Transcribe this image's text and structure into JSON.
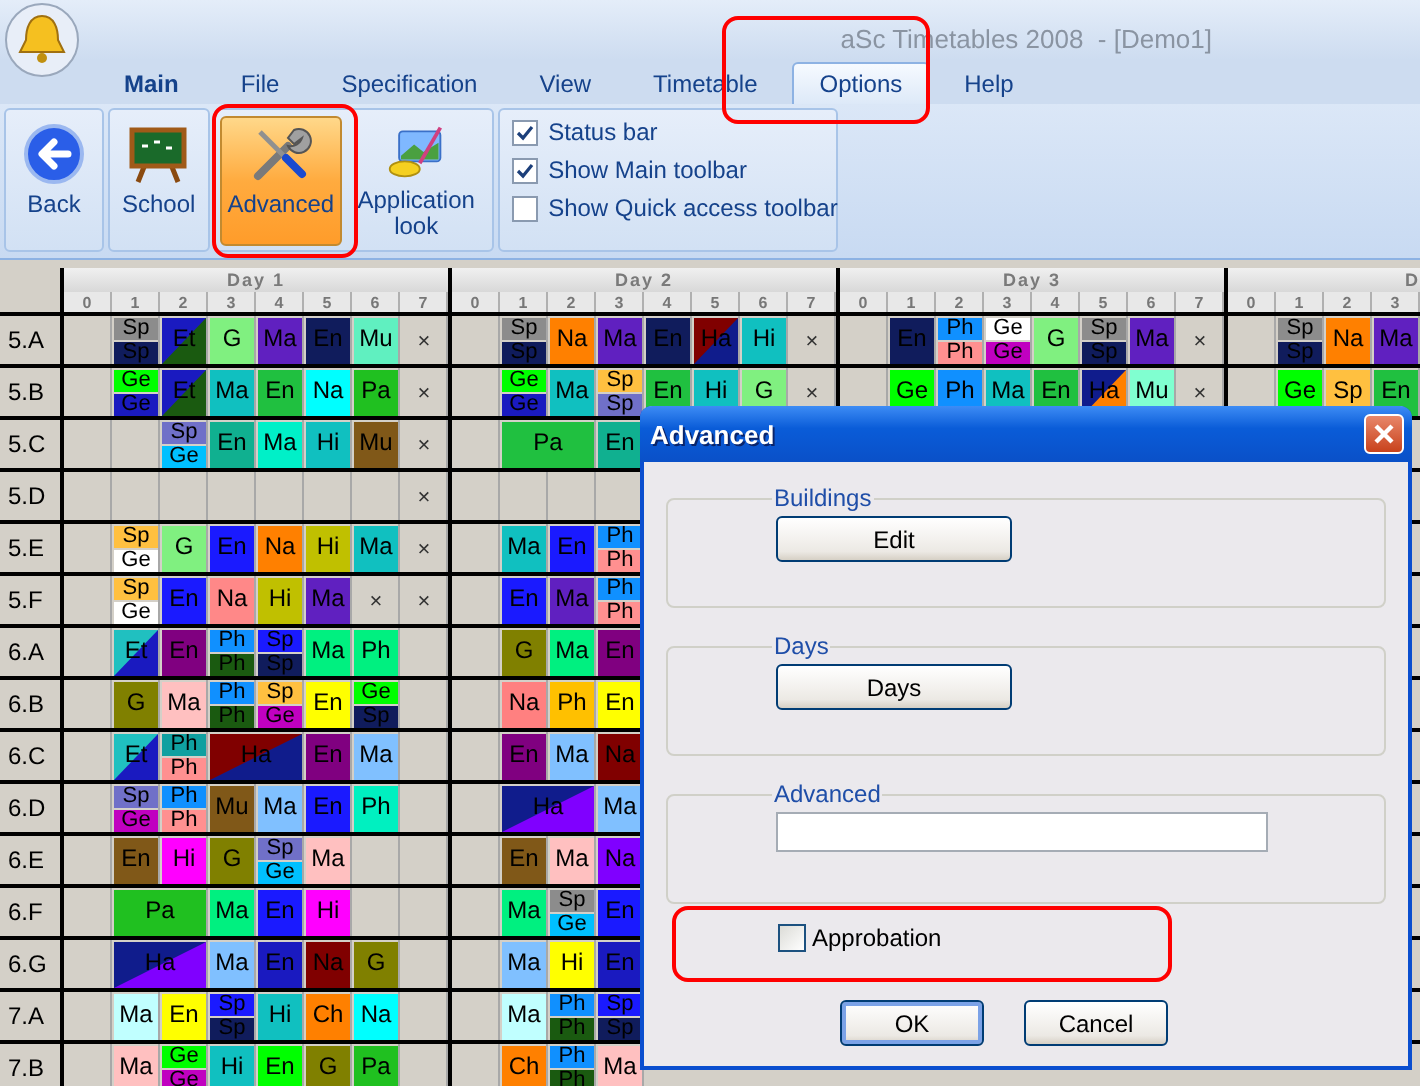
{
  "window": {
    "title": "aSc Timetables 2008  - [Demo1]"
  },
  "tabs": [
    {
      "label": "Main",
      "bold": true,
      "selected": false
    },
    {
      "label": "File",
      "bold": false,
      "selected": false
    },
    {
      "label": "Specification",
      "bold": false,
      "selected": false
    },
    {
      "label": "View",
      "bold": false,
      "selected": false
    },
    {
      "label": "Timetable",
      "bold": false,
      "selected": false
    },
    {
      "label": "Options",
      "bold": false,
      "selected": true
    },
    {
      "label": "Help",
      "bold": false,
      "selected": false
    }
  ],
  "ribbon": {
    "groups": [
      [
        {
          "label": "Back",
          "kind": "back",
          "selected": false
        }
      ],
      [
        {
          "label": "School",
          "kind": "school",
          "selected": false
        }
      ],
      [
        {
          "label": "Advanced",
          "kind": "tools",
          "selected": true
        },
        {
          "label": "Application look",
          "kind": "look",
          "selected": false
        }
      ]
    ],
    "options": [
      {
        "label": "Status bar",
        "checked": true
      },
      {
        "label": "Show Main toolbar",
        "checked": true
      },
      {
        "label": "Show Quick access toolbar",
        "checked": false
      }
    ]
  },
  "timetable": {
    "days": [
      {
        "label": "Day 1",
        "periods": [
          "0",
          "1",
          "2",
          "3",
          "4",
          "5",
          "6",
          "7"
        ]
      },
      {
        "label": "Day 2",
        "periods": [
          "0",
          "1",
          "2",
          "3",
          "4",
          "5",
          "6",
          "7"
        ]
      },
      {
        "label": "Day 3",
        "periods": [
          "0",
          "1",
          "2",
          "3",
          "4",
          "5",
          "6",
          "7"
        ]
      },
      {
        "label": "D",
        "periods": [
          "0",
          "1",
          "2",
          "3"
        ]
      }
    ],
    "rows": [
      {
        "label": "5.A",
        "days": [
          [
            {
              "kind": "empty"
            },
            {
              "kind": "split",
              "top": {
                "text": "Sp",
                "color": "#8c8c8c"
              },
              "bottom": {
                "text": "Sp",
                "color": "#101c5c"
              }
            },
            {
              "kind": "diagonal",
              "text": "Et",
              "color": "#1a1ac0",
              "corner": {
                "color": "#1a5a10"
              }
            },
            {
              "kind": "lesson",
              "text": "G",
              "color": "#80f080"
            },
            {
              "kind": "lesson",
              "text": "Ma",
              "color": "#6020c0"
            },
            {
              "kind": "lesson",
              "text": "En",
              "color": "#101c5c"
            },
            {
              "kind": "lesson",
              "text": "Mu",
              "color": "#60f0c0"
            },
            {
              "kind": "cross",
              "text": "×"
            }
          ],
          [
            {
              "kind": "empty"
            },
            {
              "kind": "split",
              "top": {
                "text": "Sp",
                "color": "#8c8c8c"
              },
              "bottom": {
                "text": "Sp",
                "color": "#101c5c"
              }
            },
            {
              "kind": "lesson",
              "text": "Na",
              "color": "#ff8000"
            },
            {
              "kind": "lesson",
              "text": "Ma",
              "color": "#6020c0"
            },
            {
              "kind": "lesson",
              "text": "En",
              "color": "#101c5c"
            },
            {
              "kind": "diagonal",
              "text": "Ha",
              "color": "#800000",
              "corner": {
                "color": "#101c8c"
              }
            },
            {
              "kind": "lesson",
              "text": "Hi",
              "color": "#10c0c0"
            },
            {
              "kind": "cross",
              "text": "×"
            }
          ],
          [
            {
              "kind": "empty"
            },
            {
              "kind": "lesson",
              "text": "En",
              "color": "#101c5c"
            },
            {
              "kind": "split",
              "top": {
                "text": "Ph",
                "color": "#1090ff"
              },
              "bottom": {
                "text": "Ph",
                "color": "#ff9090"
              }
            },
            {
              "kind": "split",
              "top": {
                "text": "Ge",
                "color": "#ffffff"
              },
              "bottom": {
                "text": "Ge",
                "color": "#c000c0"
              }
            },
            {
              "kind": "lesson",
              "text": "G",
              "color": "#80f080"
            },
            {
              "kind": "split",
              "top": {
                "text": "Sp",
                "color": "#8c8c8c"
              },
              "bottom": {
                "text": "Sp",
                "color": "#101c5c"
              }
            },
            {
              "kind": "lesson",
              "text": "Ma",
              "color": "#6020c0"
            },
            {
              "kind": "cross",
              "text": "×"
            }
          ],
          [
            {
              "kind": "empty"
            },
            {
              "kind": "split",
              "top": {
                "text": "Sp",
                "color": "#8c8c8c"
              },
              "bottom": {
                "text": "Sp",
                "color": "#101c5c"
              }
            },
            {
              "kind": "lesson",
              "text": "Na",
              "color": "#ff8000"
            },
            {
              "kind": "lesson",
              "text": "Ma",
              "color": "#6020c0"
            }
          ]
        ]
      },
      {
        "label": "5.B",
        "days": [
          [
            {
              "kind": "empty"
            },
            {
              "kind": "split",
              "top": {
                "text": "Ge",
                "color": "#00ff00"
              },
              "bottom": {
                "text": "Ge",
                "color": "#1a1ac0"
              }
            },
            {
              "kind": "diagonal",
              "text": "Et",
              "color": "#1a1ac0",
              "corner": {
                "color": "#1a5a10"
              }
            },
            {
              "kind": "lesson",
              "text": "Ma",
              "color": "#10c0c0"
            },
            {
              "kind": "lesson",
              "text": "En",
              "color": "#20c040"
            },
            {
              "kind": "lesson",
              "text": "Na",
              "color": "#00ffff"
            },
            {
              "kind": "lesson",
              "text": "Pa",
              "color": "#20c020"
            },
            {
              "kind": "cross",
              "text": "×"
            }
          ],
          [
            {
              "kind": "empty"
            },
            {
              "kind": "split",
              "top": {
                "text": "Ge",
                "color": "#00ff00"
              },
              "bottom": {
                "text": "Ge",
                "color": "#1a1ac0"
              }
            },
            {
              "kind": "lesson",
              "text": "Ma",
              "color": "#10c0c0"
            },
            {
              "kind": "split",
              "top": {
                "text": "Sp",
                "color": "#ffc040"
              },
              "bottom": {
                "text": "Sp",
                "color": "#7070c8"
              }
            },
            {
              "kind": "lesson",
              "text": "En",
              "color": "#20c040"
            },
            {
              "kind": "lesson",
              "text": "Hi",
              "color": "#10c0c0"
            },
            {
              "kind": "lesson",
              "text": "G",
              "color": "#80f080"
            },
            {
              "kind": "cross",
              "text": "×"
            }
          ],
          [
            {
              "kind": "empty"
            },
            {
              "kind": "lesson",
              "text": "Ge",
              "color": "#00ff00"
            },
            {
              "kind": "lesson",
              "text": "Ph",
              "color": "#1090ff"
            },
            {
              "kind": "lesson",
              "text": "Ma",
              "color": "#10c0c0"
            },
            {
              "kind": "lesson",
              "text": "En",
              "color": "#20c040"
            },
            {
              "kind": "diagonal",
              "text": "Ha",
              "color": "#101c8c",
              "corner": {
                "color": "#ff8000"
              }
            },
            {
              "kind": "lesson",
              "text": "Mu",
              "color": "#80ffd0"
            },
            {
              "kind": "cross",
              "text": "×"
            }
          ],
          [
            {
              "kind": "empty"
            },
            {
              "kind": "lesson",
              "text": "Ge",
              "color": "#00ff00"
            },
            {
              "kind": "lesson",
              "text": "Sp",
              "color": "#ffc040"
            },
            {
              "kind": "lesson",
              "text": "En",
              "color": "#20c040"
            }
          ]
        ]
      },
      {
        "label": "5.C",
        "days": [
          [
            {
              "kind": "empty"
            },
            {
              "kind": "empty"
            },
            {
              "kind": "split",
              "top": {
                "text": "Sp",
                "color": "#7070c8"
              },
              "bottom": {
                "text": "Ge",
                "color": "#00c0ff"
              }
            },
            {
              "kind": "lesson",
              "text": "En",
              "color": "#10b090"
            },
            {
              "kind": "lesson",
              "text": "Ma",
              "color": "#00f0c8"
            },
            {
              "kind": "lesson",
              "text": "Hi",
              "color": "#10c0c0"
            },
            {
              "kind": "lesson",
              "text": "Mu",
              "color": "#805818"
            },
            {
              "kind": "cross",
              "text": "×"
            }
          ],
          [
            {
              "kind": "empty"
            },
            {
              "kind": "lesson",
              "text": "Pa",
              "color": "#20c040",
              "wide": true
            },
            {
              "kind": "lesson",
              "text": "En",
              "color": "#10b090"
            }
          ]
        ]
      },
      {
        "label": "5.D",
        "days": [
          [
            {
              "kind": "empty"
            },
            {
              "kind": "empty"
            },
            {
              "kind": "empty"
            },
            {
              "kind": "empty"
            },
            {
              "kind": "empty"
            },
            {
              "kind": "empty"
            },
            {
              "kind": "empty"
            },
            {
              "kind": "cross",
              "text": "×"
            }
          ],
          [
            {
              "kind": "empty"
            },
            {
              "kind": "empty"
            },
            {
              "kind": "empty"
            },
            {
              "kind": "empty"
            }
          ]
        ]
      },
      {
        "label": "5.E",
        "days": [
          [
            {
              "kind": "empty"
            },
            {
              "kind": "split",
              "top": {
                "text": "Sp",
                "color": "#ffc040"
              },
              "bottom": {
                "text": "Ge",
                "color": "#ffffff"
              }
            },
            {
              "kind": "lesson",
              "text": "G",
              "color": "#80f080"
            },
            {
              "kind": "lesson",
              "text": "En",
              "color": "#1a1aff"
            },
            {
              "kind": "lesson",
              "text": "Na",
              "color": "#ff8000"
            },
            {
              "kind": "lesson",
              "text": "Hi",
              "color": "#c0c000"
            },
            {
              "kind": "lesson",
              "text": "Ma",
              "color": "#10c0c0"
            },
            {
              "kind": "cross",
              "text": "×"
            }
          ],
          [
            {
              "kind": "empty"
            },
            {
              "kind": "lesson",
              "text": "Ma",
              "color": "#10c0c0"
            },
            {
              "kind": "lesson",
              "text": "En",
              "color": "#1a1aff"
            },
            {
              "kind": "split",
              "top": {
                "text": "Ph",
                "color": "#1090ff"
              },
              "bottom": {
                "text": "Ph",
                "color": "#ff9090"
              }
            }
          ]
        ]
      },
      {
        "label": "5.F",
        "days": [
          [
            {
              "kind": "empty"
            },
            {
              "kind": "split",
              "top": {
                "text": "Sp",
                "color": "#ffc040"
              },
              "bottom": {
                "text": "Ge",
                "color": "#ffffff"
              }
            },
            {
              "kind": "lesson",
              "text": "En",
              "color": "#1a1aff"
            },
            {
              "kind": "lesson",
              "text": "Na",
              "color": "#ff8888"
            },
            {
              "kind": "lesson",
              "text": "Hi",
              "color": "#c0c000"
            },
            {
              "kind": "lesson",
              "text": "Ma",
              "color": "#6020c0"
            },
            {
              "kind": "cross",
              "text": "×"
            },
            {
              "kind": "cross",
              "text": "×"
            }
          ],
          [
            {
              "kind": "empty"
            },
            {
              "kind": "lesson",
              "text": "En",
              "color": "#1a1aff"
            },
            {
              "kind": "lesson",
              "text": "Ma",
              "color": "#6020c0"
            },
            {
              "kind": "split",
              "top": {
                "text": "Ph",
                "color": "#1090ff"
              },
              "bottom": {
                "text": "Ph",
                "color": "#ff9090"
              }
            }
          ]
        ]
      },
      {
        "label": "6.A",
        "days": [
          [
            {
              "kind": "empty"
            },
            {
              "kind": "diagonal",
              "text": "Et",
              "color": "#20c0c0",
              "corner": {
                "color": "#1a1ac0"
              }
            },
            {
              "kind": "lesson",
              "text": "En",
              "color": "#800080"
            },
            {
              "kind": "split",
              "top": {
                "text": "Ph",
                "color": "#1090ff"
              },
              "bottom": {
                "text": "Ph",
                "color": "#1a5a10"
              }
            },
            {
              "kind": "split",
              "top": {
                "text": "Sp",
                "color": "#1a1aff"
              },
              "bottom": {
                "text": "Sp",
                "color": "#101c5c"
              }
            },
            {
              "kind": "lesson",
              "text": "Ma",
              "color": "#00f080"
            },
            {
              "kind": "lesson",
              "text": "Ph",
              "color": "#00f080"
            },
            {
              "kind": "empty"
            }
          ],
          [
            {
              "kind": "empty"
            },
            {
              "kind": "lesson",
              "text": "G",
              "color": "#808000"
            },
            {
              "kind": "lesson",
              "text": "Ma",
              "color": "#00f080"
            },
            {
              "kind": "lesson",
              "text": "En",
              "color": "#800080"
            }
          ]
        ]
      },
      {
        "label": "6.B",
        "days": [
          [
            {
              "kind": "empty"
            },
            {
              "kind": "lesson",
              "text": "G",
              "color": "#808000"
            },
            {
              "kind": "lesson",
              "text": "Ma",
              "color": "#ffc0c0"
            },
            {
              "kind": "split",
              "top": {
                "text": "Ph",
                "color": "#1090ff"
              },
              "bottom": {
                "text": "Ph",
                "color": "#1a5a10"
              }
            },
            {
              "kind": "split",
              "top": {
                "text": "Sp",
                "color": "#ffc040"
              },
              "bottom": {
                "text": "Ge",
                "color": "#c000c0"
              }
            },
            {
              "kind": "lesson",
              "text": "En",
              "color": "#ffff00"
            },
            {
              "kind": "split",
              "top": {
                "text": "Ge",
                "color": "#00ff00"
              },
              "bottom": {
                "text": "Sp",
                "color": "#101c5c"
              }
            },
            {
              "kind": "empty"
            }
          ],
          [
            {
              "kind": "empty"
            },
            {
              "kind": "lesson",
              "text": "Na",
              "color": "#ff8080"
            },
            {
              "kind": "lesson",
              "text": "Ph",
              "color": "#ffc000"
            },
            {
              "kind": "lesson",
              "text": "En",
              "color": "#ffff00"
            }
          ]
        ]
      },
      {
        "label": "6.C",
        "days": [
          [
            {
              "kind": "empty"
            },
            {
              "kind": "diagonal",
              "text": "Et",
              "color": "#20c0c0",
              "corner": {
                "color": "#1a1ac0"
              }
            },
            {
              "kind": "split",
              "top": {
                "text": "Ph",
                "color": "#10a0a0"
              },
              "bottom": {
                "text": "Ph",
                "color": "#ff9090"
              }
            },
            {
              "kind": "diagonal",
              "text": "Ha",
              "color": "#800000",
              "corner": {
                "color": "#101c8c"
              },
              "wide": true
            },
            {
              "kind": "lesson",
              "text": "En",
              "color": "#800080"
            },
            {
              "kind": "lesson",
              "text": "Ma",
              "color": "#80c0ff"
            },
            {
              "kind": "empty"
            }
          ],
          [
            {
              "kind": "empty"
            },
            {
              "kind": "lesson",
              "text": "En",
              "color": "#800080"
            },
            {
              "kind": "lesson",
              "text": "Ma",
              "color": "#80c0ff"
            },
            {
              "kind": "lesson",
              "text": "Na",
              "color": "#800000"
            }
          ]
        ]
      },
      {
        "label": "6.D",
        "days": [
          [
            {
              "kind": "empty"
            },
            {
              "kind": "split",
              "top": {
                "text": "Sp",
                "color": "#7070c8"
              },
              "bottom": {
                "text": "Ge",
                "color": "#c000c0"
              }
            },
            {
              "kind": "split",
              "top": {
                "text": "Ph",
                "color": "#1090ff"
              },
              "bottom": {
                "text": "Ph",
                "color": "#ff9090"
              }
            },
            {
              "kind": "lesson",
              "text": "Mu",
              "color": "#805818"
            },
            {
              "kind": "lesson",
              "text": "Ma",
              "color": "#80c0ff"
            },
            {
              "kind": "lesson",
              "text": "En",
              "color": "#1a1aff"
            },
            {
              "kind": "lesson",
              "text": "Ph",
              "color": "#00f0c0"
            },
            {
              "kind": "empty"
            }
          ],
          [
            {
              "kind": "empty"
            },
            {
              "kind": "diagonal",
              "text": "Ha",
              "color": "#101c8c",
              "corner": {
                "color": "#8000ff"
              },
              "wide": true
            },
            {
              "kind": "lesson",
              "text": "Ma",
              "color": "#80c0ff"
            }
          ]
        ]
      },
      {
        "label": "6.E",
        "days": [
          [
            {
              "kind": "empty"
            },
            {
              "kind": "lesson",
              "text": "En",
              "color": "#805818"
            },
            {
              "kind": "lesson",
              "text": "Hi",
              "color": "#ff00ff"
            },
            {
              "kind": "lesson",
              "text": "G",
              "color": "#808000"
            },
            {
              "kind": "split",
              "top": {
                "text": "Sp",
                "color": "#7070c8"
              },
              "bottom": {
                "text": "Ge",
                "color": "#00c0ff"
              }
            },
            {
              "kind": "lesson",
              "text": "Ma",
              "color": "#ffc0c0"
            },
            {
              "kind": "empty"
            },
            {
              "kind": "empty"
            }
          ],
          [
            {
              "kind": "empty"
            },
            {
              "kind": "lesson",
              "text": "En",
              "color": "#805818"
            },
            {
              "kind": "lesson",
              "text": "Ma",
              "color": "#ffc0c0"
            },
            {
              "kind": "lesson",
              "text": "Na",
              "color": "#8000ff"
            }
          ]
        ]
      },
      {
        "label": "6.F",
        "days": [
          [
            {
              "kind": "empty"
            },
            {
              "kind": "lesson",
              "text": "Pa",
              "color": "#20c020",
              "wide": true
            },
            {
              "kind": "lesson",
              "text": "Ma",
              "color": "#00f080"
            },
            {
              "kind": "lesson",
              "text": "En",
              "color": "#1a1aff"
            },
            {
              "kind": "lesson",
              "text": "Hi",
              "color": "#ff00ff"
            },
            {
              "kind": "empty"
            },
            {
              "kind": "empty"
            }
          ],
          [
            {
              "kind": "empty"
            },
            {
              "kind": "lesson",
              "text": "Ma",
              "color": "#00f080"
            },
            {
              "kind": "split",
              "top": {
                "text": "Sp",
                "color": "#8c8c8c"
              },
              "bottom": {
                "text": "Ge",
                "color": "#00c0ff"
              }
            },
            {
              "kind": "lesson",
              "text": "En",
              "color": "#1a1aff"
            }
          ]
        ]
      },
      {
        "label": "6.G",
        "days": [
          [
            {
              "kind": "empty"
            },
            {
              "kind": "diagonal",
              "text": "Ha",
              "color": "#101c8c",
              "corner": {
                "color": "#8000ff"
              },
              "wide": true
            },
            {
              "kind": "lesson",
              "text": "Ma",
              "color": "#80c0ff"
            },
            {
              "kind": "lesson",
              "text": "En",
              "color": "#1a1ac0"
            },
            {
              "kind": "lesson",
              "text": "Na",
              "color": "#800000"
            },
            {
              "kind": "lesson",
              "text": "G",
              "color": "#808000"
            },
            {
              "kind": "empty"
            }
          ],
          [
            {
              "kind": "empty"
            },
            {
              "kind": "lesson",
              "text": "Ma",
              "color": "#80c0ff"
            },
            {
              "kind": "lesson",
              "text": "Hi",
              "color": "#ffff00"
            },
            {
              "kind": "lesson",
              "text": "En",
              "color": "#1a1ac0"
            }
          ]
        ]
      },
      {
        "label": "7.A",
        "days": [
          [
            {
              "kind": "empty"
            },
            {
              "kind": "lesson",
              "text": "Ma",
              "color": "#c0ffff"
            },
            {
              "kind": "lesson",
              "text": "En",
              "color": "#ffff00"
            },
            {
              "kind": "split",
              "top": {
                "text": "Sp",
                "color": "#1a1aff"
              },
              "bottom": {
                "text": "Sp",
                "color": "#101c5c"
              }
            },
            {
              "kind": "lesson",
              "text": "Hi",
              "color": "#10c0c0"
            },
            {
              "kind": "lesson",
              "text": "Ch",
              "color": "#ff8000"
            },
            {
              "kind": "lesson",
              "text": "Na",
              "color": "#00ffff"
            },
            {
              "kind": "empty"
            }
          ],
          [
            {
              "kind": "empty"
            },
            {
              "kind": "lesson",
              "text": "Ma",
              "color": "#c0ffff"
            },
            {
              "kind": "split",
              "top": {
                "text": "Ph",
                "color": "#1090ff"
              },
              "bottom": {
                "text": "Ph",
                "color": "#1a5a10"
              }
            },
            {
              "kind": "split",
              "top": {
                "text": "Sp",
                "color": "#1a1aff"
              },
              "bottom": {
                "text": "Sp",
                "color": "#101c5c"
              }
            }
          ]
        ]
      },
      {
        "label": "7.B",
        "days": [
          [
            {
              "kind": "empty"
            },
            {
              "kind": "lesson",
              "text": "Ma",
              "color": "#ffc0c0"
            },
            {
              "kind": "split",
              "top": {
                "text": "Ge",
                "color": "#00ff00"
              },
              "bottom": {
                "text": "Ge",
                "color": "#c000c0"
              }
            },
            {
              "kind": "lesson",
              "text": "Hi",
              "color": "#10c0c0"
            },
            {
              "kind": "lesson",
              "text": "En",
              "color": "#00ff00"
            },
            {
              "kind": "lesson",
              "text": "G",
              "color": "#808000"
            },
            {
              "kind": "lesson",
              "text": "Pa",
              "color": "#20c020"
            },
            {
              "kind": "empty"
            }
          ],
          [
            {
              "kind": "empty"
            },
            {
              "kind": "lesson",
              "text": "Ch",
              "color": "#ff8000"
            },
            {
              "kind": "split",
              "top": {
                "text": "Ph",
                "color": "#1090ff"
              },
              "bottom": {
                "text": "Ph",
                "color": "#1a5a10"
              }
            },
            {
              "kind": "lesson",
              "text": "Ma",
              "color": "#ffc0c0"
            }
          ]
        ]
      }
    ]
  },
  "dialog": {
    "title": "Advanced",
    "groups": [
      {
        "kind": "button",
        "legend": "Buildings",
        "button": "Edit"
      },
      {
        "kind": "button",
        "legend": "Days",
        "button": "Days"
      },
      {
        "kind": "field",
        "legend": "Advanced"
      }
    ],
    "checkbox": {
      "label": "Approbation",
      "checked": false
    },
    "buttons": [
      {
        "label": "OK",
        "default": true
      },
      {
        "label": "Cancel",
        "default": false
      }
    ]
  }
}
